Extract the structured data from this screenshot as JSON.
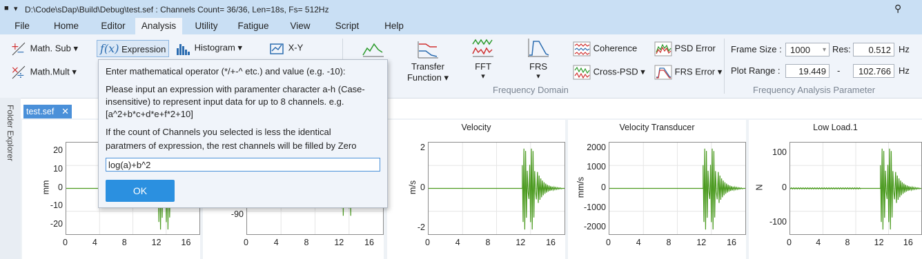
{
  "window": {
    "title": "D:\\Code\\sDap\\Build\\Debug\\test.sef : Channels Count= 36/36, Len=18s, Fs= 512Hz"
  },
  "menu": [
    "File",
    "Home",
    "Editor",
    "Analysis",
    "Utility",
    "Fatigue",
    "View",
    "Script",
    "Help"
  ],
  "menu_active": "Analysis",
  "ribbon": {
    "math_sub": "Math. Sub",
    "math_mult": "Math.Mult",
    "expression": "Expression",
    "histogram": "Histogram",
    "xy": "X-Y",
    "transfer_line1": "Transfer",
    "transfer_line2": "Function",
    "fft": "FFT",
    "frs": "FRS",
    "coherence": "Coherence",
    "cross_psd": "Cross-PSD",
    "psd_error": "PSD Error",
    "frs_error": "FRS Error",
    "freq_domain_label": "Frequency Domain",
    "frame_size_label": "Frame Size :",
    "frame_size_value": "1000",
    "res_label": "Res:",
    "res_value": "0.512",
    "hz1": "Hz",
    "plot_range_label": "Plot Range :",
    "plot_range_from": "19.449",
    "plot_range_dash": "-",
    "plot_range_to": "102.766",
    "hz2": "Hz",
    "param_label": "Frequency Analysis Parameter"
  },
  "sidebar": {
    "folder_explorer": "Folder Explorer"
  },
  "doc_tab": {
    "label": "test.sef",
    "close": "✕"
  },
  "dialog": {
    "line1": "Enter mathematical operator (*/+-^ etc.) and value (e.g. -10):",
    "line2a": "Please input an expression with paramenter character a-h (Case-",
    "line2b": "insensitive) to represent input data for up to 8 channels. e.g.",
    "line2c": "[a^2+b*c+d*e+f*2+10]",
    "line3a": "If the count of Channels you selected is less the identical",
    "line3b": "paratmers of expression, the rest channels will be filled by Zero",
    "input_value": "log(a)+b^2",
    "ok_label": "OK"
  },
  "panels": [
    {
      "title": "Di",
      "unit": "mm",
      "yticks": [
        "20",
        "10",
        "0",
        "-10",
        "-20"
      ],
      "xticks": [
        "0",
        "4",
        "8",
        "12",
        "16"
      ]
    },
    {
      "title": "",
      "unit": "",
      "yticks": [
        "-90"
      ],
      "xticks": [
        "0",
        "4",
        "8",
        "12",
        "16"
      ]
    },
    {
      "title": "Velocity",
      "unit": "m/s",
      "yticks": [
        "2",
        "0",
        "-2"
      ],
      "xticks": [
        "0",
        "4",
        "8",
        "12",
        "16"
      ]
    },
    {
      "title": "Velocity Transducer",
      "unit": "mm/s",
      "yticks": [
        "2000",
        "1000",
        "0",
        "-1000",
        "-2000"
      ],
      "xticks": [
        "0",
        "4",
        "8",
        "12",
        "16"
      ]
    },
    {
      "title": "Low Load.1",
      "unit": "N",
      "yticks": [
        "100",
        "0",
        "-100"
      ],
      "xticks": [
        "0",
        "4",
        "8",
        "12",
        "16"
      ]
    }
  ],
  "colors": {
    "signal": "#4a9a1e",
    "accent": "#2b90e0",
    "titlebar": "#c9dff4"
  }
}
